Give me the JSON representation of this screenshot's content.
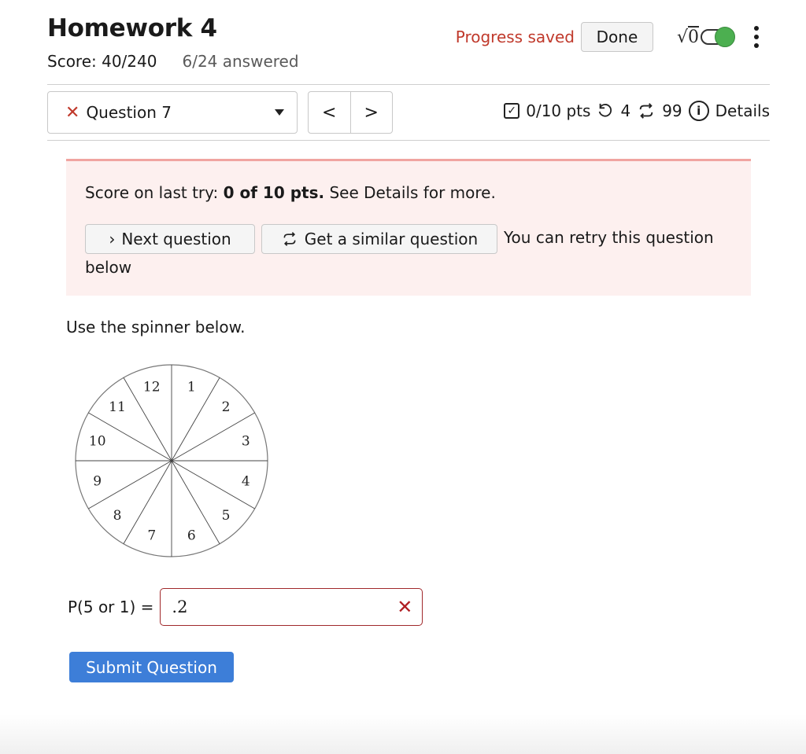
{
  "header": {
    "title": "Homework 4",
    "score": "Score: 40/240",
    "answered": "6/24 answered",
    "progress_saved": "Progress saved",
    "done_label": "Done",
    "sqrt_label": "√",
    "sqrt_zero": "0"
  },
  "question_nav": {
    "selected_question": "Question 7",
    "prev_symbol": "<",
    "next_symbol": ">",
    "points": "0/10 pts",
    "retries": "4",
    "similar_count": "99",
    "details_label": "Details"
  },
  "alert": {
    "score_prefix": "Score on last try: ",
    "score_bold": "0 of 10 pts.",
    "score_suffix": " See Details for more.",
    "next_question_label": "Next question",
    "similar_question_label": "Get a similar question",
    "retry_text": "You can retry this question below"
  },
  "question": {
    "prompt": "Use the spinner below.",
    "spinner_numbers": [
      "1",
      "2",
      "3",
      "4",
      "5",
      "6",
      "7",
      "8",
      "9",
      "10",
      "11",
      "12"
    ],
    "answer_label": "P(5 or 1) =",
    "answer_value": ".2",
    "submit_label": "Submit Question"
  },
  "colors": {
    "accent": "#3d7ed8",
    "error": "#c0392b",
    "alert_bg": "#fdf0ef",
    "toggle_on": "#4caf50"
  },
  "icons": {
    "question_status": "x-icon",
    "points": "checkbox-icon",
    "retries": "retry-icon",
    "similar": "repeat-icon",
    "details": "info-icon"
  }
}
